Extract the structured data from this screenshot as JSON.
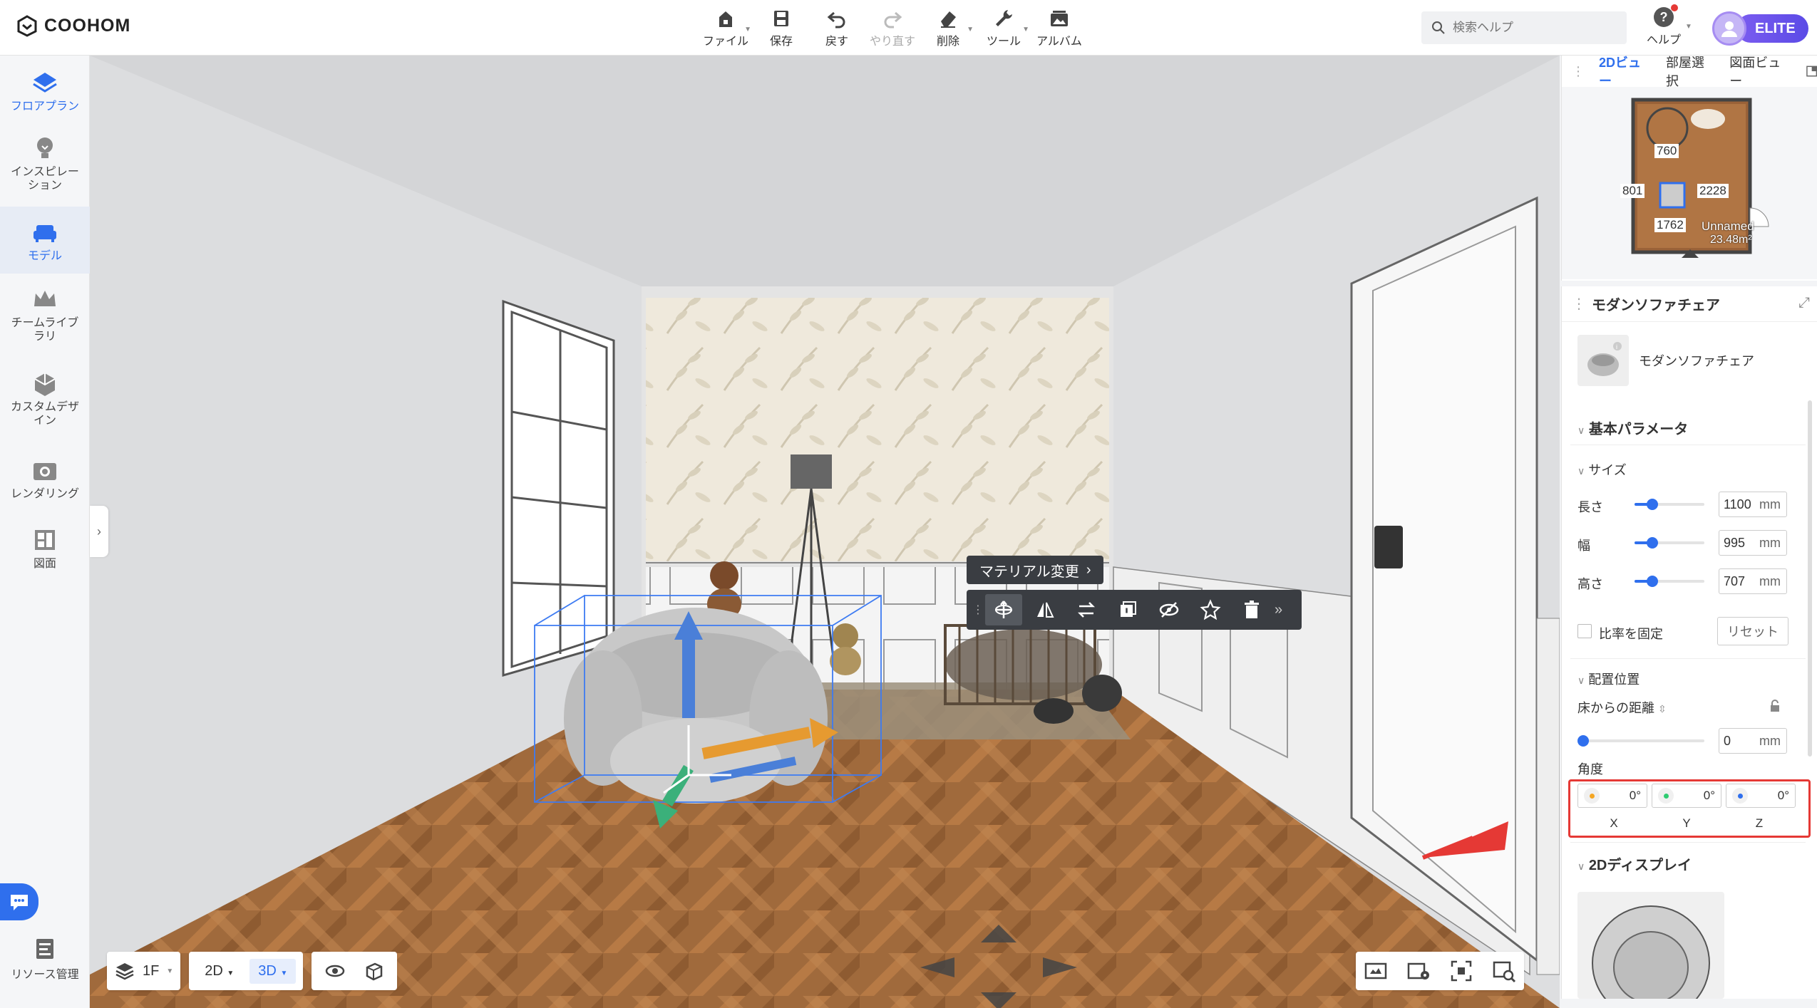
{
  "app": {
    "logo_text": "COOHOM",
    "help_label": "ヘルプ",
    "elite_label": "ELITE"
  },
  "toolbar": {
    "items": [
      {
        "label": "ファイル",
        "icon": "home-file-icon",
        "has_dropdown": true
      },
      {
        "label": "保存",
        "icon": "save-icon",
        "has_dropdown": false
      },
      {
        "label": "戻す",
        "icon": "undo-icon",
        "has_dropdown": false
      },
      {
        "label": "やり直す",
        "icon": "redo-icon",
        "has_dropdown": false,
        "disabled": true
      },
      {
        "label": "削除",
        "icon": "eraser-icon",
        "has_dropdown": true
      },
      {
        "label": "ツール",
        "icon": "wrench-icon",
        "has_dropdown": true
      },
      {
        "label": "アルバム",
        "icon": "album-icon",
        "has_dropdown": false
      }
    ]
  },
  "search": {
    "placeholder": "検索ヘルプ"
  },
  "sidebar": {
    "items": [
      {
        "label": "フロアプラン",
        "icon": "floorplan-icon",
        "active": true
      },
      {
        "label": "インスピレーション",
        "icon": "lightbulb-icon"
      },
      {
        "label": "モデル",
        "icon": "sofa-model-icon",
        "active": true,
        "selected": true
      },
      {
        "label": "チームライブラリ",
        "icon": "crown-icon"
      },
      {
        "label": "カスタムデザイン",
        "icon": "custom-design-icon"
      },
      {
        "label": "レンダリング",
        "icon": "camera-icon"
      },
      {
        "label": "図面",
        "icon": "drawing-icon"
      }
    ],
    "resource_label": "リソース管理"
  },
  "viewport": {
    "context_label": "マテリアル変更",
    "bottom_left": {
      "floor": "1F",
      "view_2d": "2D",
      "view_3d": "3D"
    }
  },
  "right_panel": {
    "tabs": [
      "2Dビュー",
      "部屋選択",
      "図面ビュー"
    ],
    "minimap": {
      "dims": [
        "760",
        "801",
        "2228",
        "1762"
      ],
      "room_name": "Unnamed",
      "room_area": "23.48m²"
    },
    "header_title": "モダンソファチェア",
    "product_name": "モダンソファチェア",
    "section_basic": "基本パラメータ",
    "section_size": "サイズ",
    "params": [
      {
        "label": "長さ",
        "value": "1100",
        "unit": "mm",
        "fraction": 0.25
      },
      {
        "label": "幅",
        "value": "995",
        "unit": "mm",
        "fraction": 0.25
      },
      {
        "label": "高さ",
        "value": "707",
        "unit": "mm",
        "fraction": 0.25
      }
    ],
    "lock_ratio_label": "比率を固定",
    "reset_label": "リセット",
    "section_position": "配置位置",
    "floor_distance_label": "床からの距離",
    "floor_distance": {
      "value": "0",
      "unit": "mm",
      "fraction": 0
    },
    "angle_label": "角度",
    "angles": [
      {
        "axis": "X",
        "value": "0",
        "unit": "°",
        "color": "#f5a623"
      },
      {
        "axis": "Y",
        "value": "0",
        "unit": "°",
        "color": "#2ecc71"
      },
      {
        "axis": "Z",
        "value": "0",
        "unit": "°",
        "color": "#2f6fed"
      }
    ],
    "section_display": "2Dディスプレイ"
  },
  "colors": {
    "accent": "#2f6fed",
    "highlight": "#e53935",
    "elite_gradient_start": "#7b5cf0",
    "elite_gradient_end": "#5b4be6"
  }
}
